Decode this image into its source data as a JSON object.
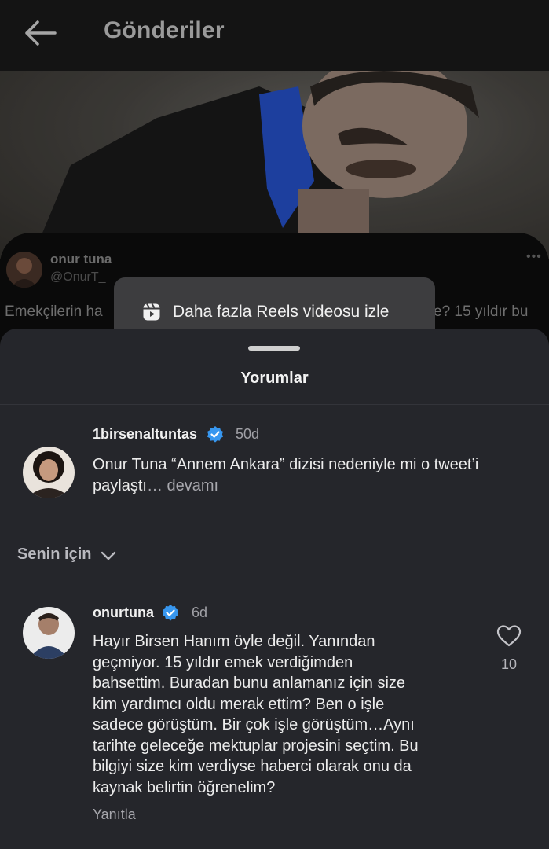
{
  "header": {
    "title": "Gönderiler",
    "back_icon": "arrow-left-icon"
  },
  "tweet": {
    "author_name": "onur tuna",
    "author_handle": "@OnurT_",
    "text_left": "Emekçilerin ha",
    "text_right": "e? 15 yıldır bu",
    "more_icon": "ellipsis-icon"
  },
  "reels_button": {
    "label": "Daha fazla Reels videosu izle",
    "icon": "reels-icon"
  },
  "comments_sheet": {
    "title": "Yorumlar",
    "pinned_comment": {
      "username": "1birsenaltuntas",
      "verified": true,
      "time": "50d",
      "text": "Onur Tuna “Annem Ankara” dizisi nedeniyle mi o tweet’i paylaştı",
      "more_label": "… devamı"
    },
    "filter": {
      "label": "Senin için",
      "icon": "chevron-down-icon"
    },
    "comment": {
      "username": "onurtuna",
      "verified": true,
      "time": "6d",
      "lines": [
        "Hayır Birsen Hanım öyle değil. Yanından",
        "geçmiyor. 15 yıldır emek verdiğimden",
        "bahsettim. Buradan bunu anlamanız için size",
        "kim yardımcı oldu merak ettim? Ben o işle",
        "sadece görüştüm.  Bir çok işle görüştüm…Aynı",
        "tarihte geleceğe mektuplar projesini seçtim. Bu",
        "bilgiyi size kim verdiyse haberci olarak onu da",
        "kaynak belirtin öğrenelim?"
      ],
      "like_count": "10",
      "reply_label": "Yanıtla"
    }
  },
  "colors": {
    "sheet_bg": "#25262b",
    "verified_blue": "#3797f0",
    "header_bg": "#141414"
  }
}
